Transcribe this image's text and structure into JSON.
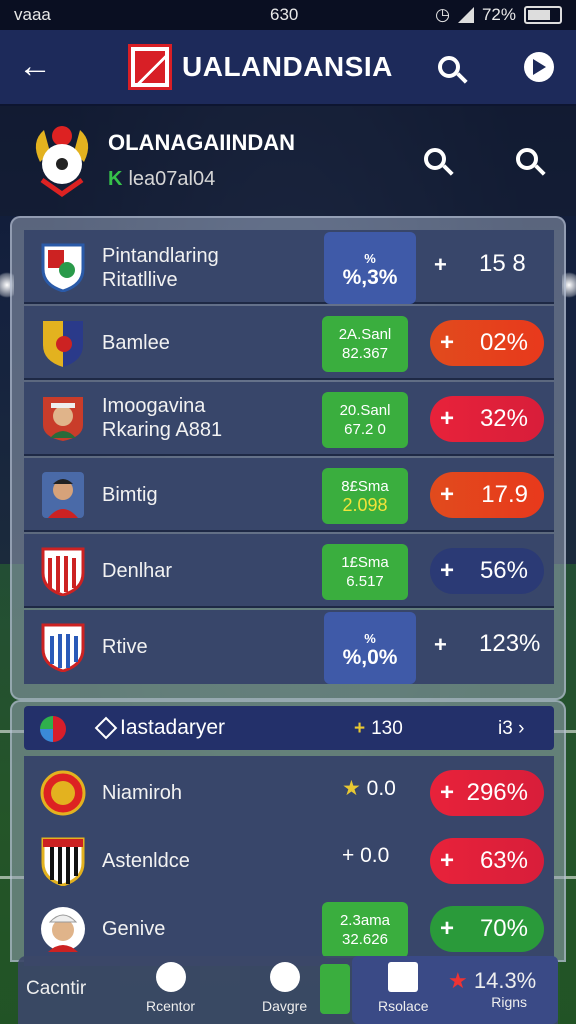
{
  "status": {
    "left": "vaaa",
    "time": "630",
    "battery": "72%"
  },
  "appbar": {
    "title": "UALANDANSIA"
  },
  "league": {
    "name": "OLANAGAIINDAN",
    "sub_icon": "K",
    "sub": "lea07al04"
  },
  "rows1": [
    {
      "label1": "Pintandlaring",
      "label2": "Ritatllive",
      "stat_top": "%",
      "stat_main": "%,3%",
      "value": "15 8",
      "kind": "plus"
    },
    {
      "label1": "Bamlee",
      "label2": "",
      "stat_top": "2A.Sanl",
      "stat_main": "82.367",
      "value": "02%",
      "kind": "red"
    },
    {
      "label1": "Imoogavina",
      "label2": "Rkaring A881",
      "stat_top": "20.Sanl",
      "stat_main": "67.2 0",
      "value": "32%",
      "kind": "crim"
    },
    {
      "label1": "Bimtig",
      "label2": "",
      "stat_top": "8£Sma",
      "stat_main": "2.098",
      "value": "17.9",
      "kind": "red"
    },
    {
      "label1": "Denlhar",
      "label2": "",
      "stat_top": "1£Sma",
      "stat_main": "6.517",
      "value": "56%",
      "kind": "navy"
    },
    {
      "label1": "Rtive",
      "label2": "",
      "stat_top": "%",
      "stat_main": "%,0%",
      "value": "123%",
      "kind": "plus"
    }
  ],
  "section2": {
    "title": "Iastadaryer",
    "num1": "130",
    "num2": "i3"
  },
  "rows2": [
    {
      "label": "Niamiroh",
      "mark": "★",
      "num": "0.0",
      "value": "296%"
    },
    {
      "label": "Astenldce",
      "mark": "+",
      "num": "0.0",
      "value": "63%"
    },
    {
      "label": "Genive",
      "stat_top": "2.3ama",
      "stat_main": "32.626",
      "value": "70%"
    }
  ],
  "nav": {
    "i0": "Cacntir",
    "i1": "Rcentor",
    "i2": "Davgre",
    "i3": "Rsolace",
    "i4_val": "14.3%",
    "i4_lbl": "Rigns"
  },
  "icons": [
    "back-arrow-icon",
    "search-icon",
    "play-circle-icon",
    "shield-icon",
    "flag-icon"
  ]
}
